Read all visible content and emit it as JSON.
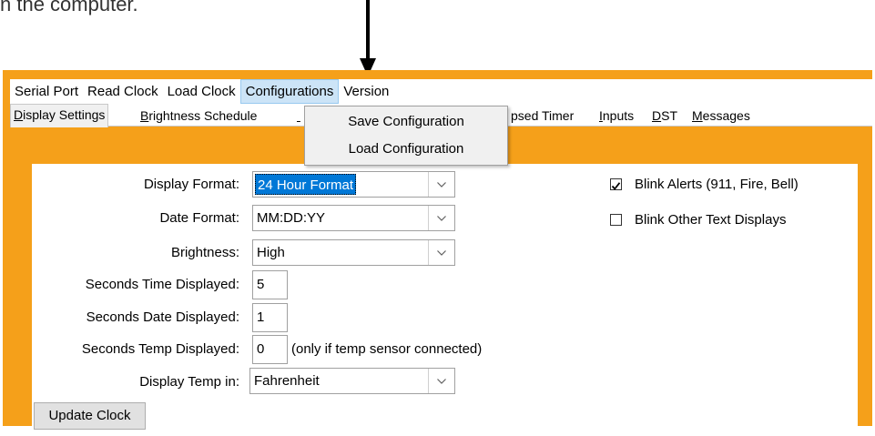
{
  "top_text": "n the computer.",
  "menubar": {
    "items": [
      "Serial Port",
      "Read Clock",
      "Load Clock",
      "Configurations",
      "Version"
    ]
  },
  "tabs": [
    {
      "prefix": "",
      "key": "D",
      "rest": "isplay Settings"
    },
    {
      "prefix": "",
      "key": "B",
      "rest": "rightness Schedule"
    },
    {
      "prefix": "",
      "key": "",
      "rest": "psed Timer"
    },
    {
      "prefix": "",
      "key": "I",
      "rest": "nputs"
    },
    {
      "prefix": "",
      "key": "D",
      "rest": "ST"
    },
    {
      "prefix": "",
      "key": "M",
      "rest": "essages"
    }
  ],
  "dropdown": {
    "items": [
      "Save Configuration",
      "Load Configuration"
    ]
  },
  "settings": {
    "display_format_label": "Display Format:",
    "display_format_value": "24 Hour Format",
    "date_format_label": "Date Format:",
    "date_format_value": "MM:DD:YY",
    "brightness_label": "Brightness:",
    "brightness_value": "High",
    "seconds_time_label": "Seconds Time Displayed:",
    "seconds_time_value": "5",
    "seconds_date_label": "Seconds Date Displayed:",
    "seconds_date_value": "1",
    "seconds_temp_label": "Seconds Temp Displayed:",
    "seconds_temp_value": "0",
    "seconds_temp_hint": "(only if temp sensor connected)",
    "temp_unit_label": "Display Temp in:",
    "temp_unit_value": "Fahrenheit",
    "blink_alerts_label": "Blink Alerts (911, Fire, Bell)",
    "blink_alerts_checked": true,
    "blink_other_label": "Blink Other Text Displays",
    "blink_other_checked": false,
    "update_button": "Update Clock"
  },
  "colors": {
    "frame": "#f5a01a",
    "selection": "#0078d7",
    "menu_open": "#cce4f7"
  }
}
